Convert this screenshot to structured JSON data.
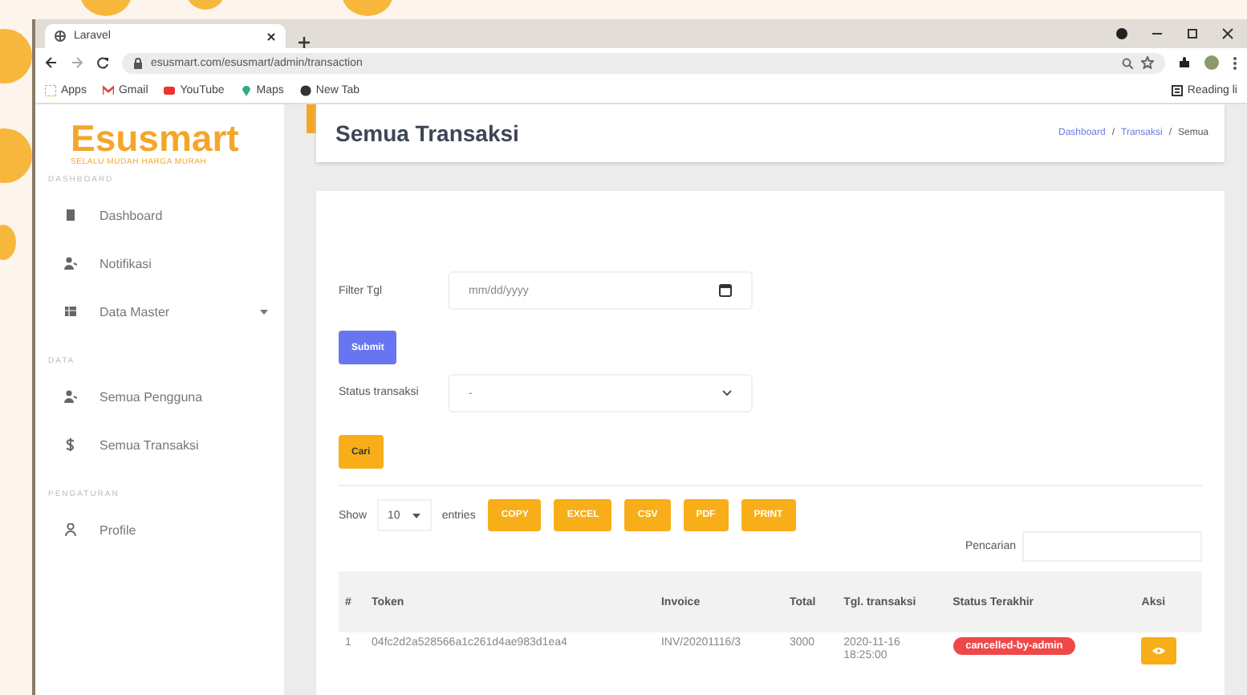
{
  "browser": {
    "tab_title": "Laravel",
    "url": "esusmart.com/esusmart/admin/transaction",
    "bookmarks": [
      "Apps",
      "Gmail",
      "YouTube",
      "Maps",
      "New Tab"
    ],
    "reading_list": "Reading li"
  },
  "sidebar": {
    "logo": "Esusmart",
    "tagline": "SELALU MUDAH HARGA MURAH",
    "sections": [
      {
        "heading": "DASHBOARD",
        "items": [
          {
            "label": "Dashboard",
            "selected": false,
            "dropdown": false
          },
          {
            "label": "Notifikasi",
            "selected": false,
            "dropdown": false
          },
          {
            "label": "Data Master",
            "selected": false,
            "dropdown": true
          }
        ]
      },
      {
        "heading": "DATA",
        "items": [
          {
            "label": "Semua Pengguna",
            "selected": false,
            "dropdown": false
          },
          {
            "label": "Semua Transaksi",
            "selected": false,
            "dropdown": false
          }
        ]
      },
      {
        "heading": "PENGATURAN",
        "items": [
          {
            "label": "Profile",
            "selected": false,
            "dropdown": false
          }
        ]
      }
    ]
  },
  "header": {
    "title": "Semua Transaksi",
    "breadcrumb": [
      "Dashboard",
      "Transaksi",
      "Semua"
    ],
    "separator": "/"
  },
  "filter": {
    "date_label": "Filter Tgl",
    "date_placeholder": "mm/dd/yyyy",
    "submit": "Submit",
    "status_label": "Status transaksi",
    "status_value": "-",
    "search_button": "Cari"
  },
  "table_controls": {
    "show": "Show",
    "page_size": "10",
    "entries": "entries",
    "exports": [
      "COPY",
      "EXCEL",
      "CSV",
      "PDF",
      "PRINT"
    ],
    "search_label": "Pencarian"
  },
  "table": {
    "columns": [
      "#",
      "Token",
      "Invoice",
      "Total",
      "Tgl. transaksi",
      "Status Terakhir",
      "Aksi"
    ],
    "rows": [
      {
        "cells": [
          "1",
          "04fc2d2a528566a1c261d4ae983d1ea4",
          "INV/20201116/3",
          "3000",
          "2020-11-16 18:25:00"
        ],
        "status": "cancelled-by-admin"
      }
    ]
  }
}
